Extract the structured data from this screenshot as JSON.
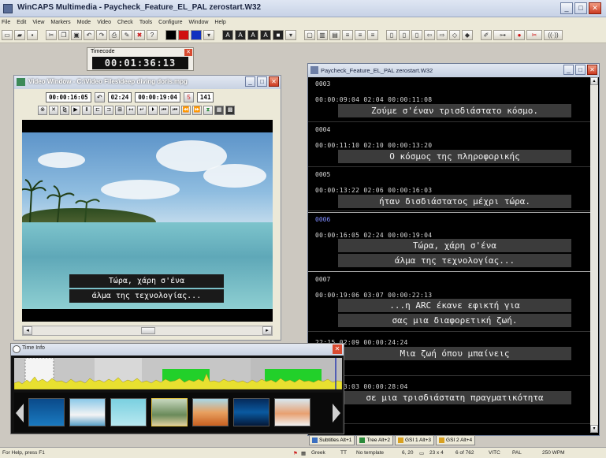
{
  "window": {
    "title": "WinCAPS Multimedia - Paycheck_Feature_EL_PAL zerostart.W32",
    "min": "_",
    "max": "□",
    "close": "✕"
  },
  "menu": [
    "File",
    "Edit",
    "View",
    "Markers",
    "Mode",
    "Video",
    "Check",
    "Tools",
    "Configure",
    "Window",
    "Help"
  ],
  "timecode": {
    "label": "Timecode",
    "value": "00:01:36:13"
  },
  "video_window": {
    "title": "Video Window - C:\\Video Files\\deep diving doris.mpg",
    "time_in": "00:00:16:05",
    "duration": "02:24",
    "time_out": "00:00:19:04",
    "count_icon": "5",
    "count": "141",
    "subtitle_lines": [
      "Τώρα, χάρη σ'ένα",
      "άλμα της τεχνολογίας..."
    ]
  },
  "subtitle_list": {
    "title": "Paycheck_Feature_EL_PAL zerostart.W32",
    "entries": [
      {
        "num": "0003",
        "times": "00:00:09:04  02:04  00:00:11:08",
        "lines": [
          "Ζούμε σ'έναν τρισδιάστατο κόσμο."
        ]
      },
      {
        "num": "0004",
        "times": "00:00:11:10  02:10  00:00:13:20",
        "lines": [
          "Ο κόσμος της πληροφορικής"
        ]
      },
      {
        "num": "0005",
        "times": "00:00:13:22  02:06  00:00:16:03",
        "lines": [
          "ήταν δισδιάστατος μέχρι τώρα."
        ]
      },
      {
        "num": "0006",
        "times": "00:00:16:05  02:24  00:00:19:04",
        "lines": [
          "Τώρα, χάρη σ'ένα",
          "άλμα της τεχνολογίας..."
        ],
        "selected": true
      },
      {
        "num": "0007",
        "times": "00:00:19:06  03:07  00:00:22:13",
        "lines": [
          "...η ARC έκανε εφικτή για",
          "σας μια διαφορετική ζωή."
        ]
      },
      {
        "num": "",
        "times": "22:15  02:09  00:00:24:24",
        "lines": [
          "Μια ζωή όπου μπαίνεις"
        ]
      },
      {
        "num": "",
        "times": "25:01  03:03  00:00:28:04",
        "lines": [
          "σε μια τρισδιάστατη πραγματικότητα"
        ]
      }
    ]
  },
  "time_info": {
    "title": "Time Info"
  },
  "tabs": [
    {
      "label": "Subtitles Alt+1",
      "icon": "#3b6fc0"
    },
    {
      "label": "Tree Alt+2",
      "icon": "#2a8a3a"
    },
    {
      "label": "GSI 1 Alt+3",
      "icon": "#d8a020"
    },
    {
      "label": "GSI 2 Alt+4",
      "icon": "#d8a020"
    }
  ],
  "status": {
    "help": "For Help, press F1",
    "language": "Greek",
    "template": "No template",
    "position": "6, 20",
    "chars": "23 x 4",
    "subtitle_count": "6 of 762",
    "timecode_std": "VITC",
    "video_std": "PAL",
    "wpm": "250 WPM"
  },
  "colors": {
    "accent": "#2d5bb8",
    "selected_num": "#7f8cff",
    "wave_green": "#22d02a",
    "wave_yellow": "#e8e030"
  }
}
